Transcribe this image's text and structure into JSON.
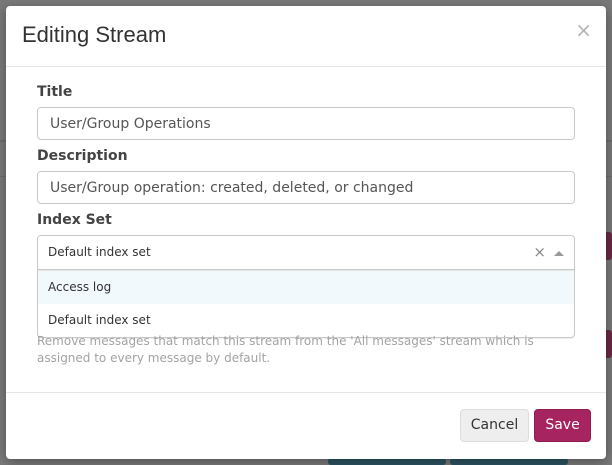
{
  "modal": {
    "title": "Editing Stream",
    "close_icon": "close-icon"
  },
  "form": {
    "title_label": "Title",
    "title_value": "User/Group Operations",
    "description_label": "Description",
    "description_value": "User/Group operation: created, deleted, or changed",
    "index_set_label": "Index Set",
    "index_set_selected": "Default index set",
    "index_set_options": [
      "Access log",
      "Default index set"
    ],
    "remove_matches_help": "Remove messages that match this stream from the 'All messages' stream which is assigned to every message by default."
  },
  "footer": {
    "cancel_label": "Cancel",
    "save_label": "Save"
  },
  "colors": {
    "accent": "#a6245f",
    "option_hover": "#f2f9fc"
  }
}
